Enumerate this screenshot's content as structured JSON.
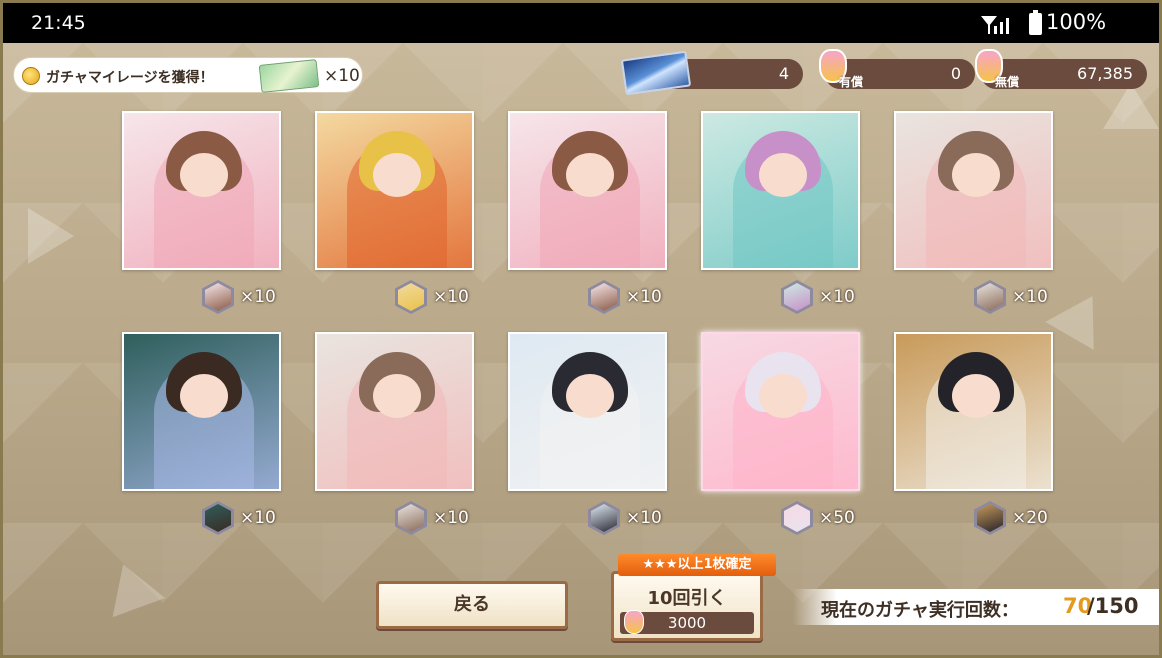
{
  "status_bar": {
    "time": "21:45",
    "battery": "100%"
  },
  "mileage": {
    "label": "ガチャマイレージを獲得！",
    "count": "×10"
  },
  "currencies": {
    "ticket": {
      "value": "4"
    },
    "paid": {
      "label": "有償",
      "value": "0"
    },
    "free": {
      "label": "無償",
      "value": "67,385"
    }
  },
  "results": [
    {
      "reward": "×10",
      "colors": [
        "#f6e6ea",
        "#8a5a44",
        "#f0a6b6"
      ]
    },
    {
      "reward": "×10",
      "colors": [
        "#f3d9a0",
        "#e8c248",
        "#e0622a"
      ]
    },
    {
      "reward": "×10",
      "colors": [
        "#f6e6ea",
        "#8a5a44",
        "#f0a6b6"
      ]
    },
    {
      "reward": "×10",
      "colors": [
        "#cde9e2",
        "#c790c8",
        "#6fc6c4"
      ]
    },
    {
      "reward": "×10",
      "colors": [
        "#e9e4df",
        "#8a6a58",
        "#f2b8b8"
      ]
    },
    {
      "reward": "×10",
      "colors": [
        "#2f5f5c",
        "#3a2a22",
        "#a9b9e8"
      ]
    },
    {
      "reward": "×10",
      "colors": [
        "#e9e4df",
        "#8a6a58",
        "#f2b8b8"
      ]
    },
    {
      "reward": "×10",
      "colors": [
        "#dfe9f2",
        "#2a2a33",
        "#f3f3f3"
      ]
    },
    {
      "reward": "×50",
      "colors": [
        "#f7d9e3",
        "#e8e3ef",
        "#ffb3c9"
      ]
    },
    {
      "reward": "×20",
      "colors": [
        "#c89a5a",
        "#25232a",
        "#f2efe8"
      ]
    }
  ],
  "back_label": "戻る",
  "pull": {
    "banner": "★★★以上1枚確定",
    "title": "10回引く",
    "cost": "3000"
  },
  "execution": {
    "label": "現在のガチャ実行回数：",
    "current": "70",
    "max": "/150"
  }
}
